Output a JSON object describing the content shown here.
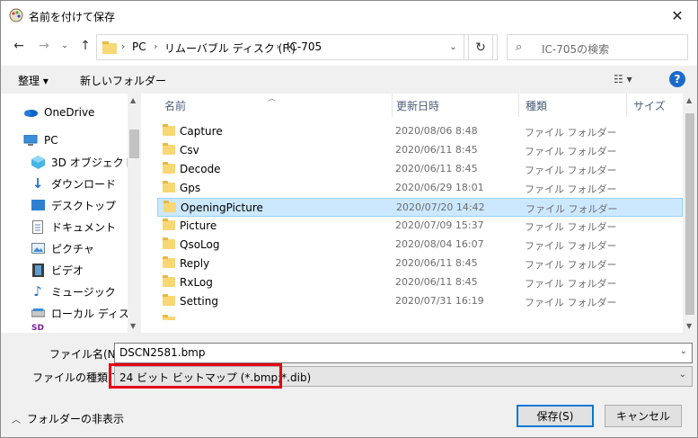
{
  "window": {
    "title": "名前を付けて保存",
    "close_glyph": "✕"
  },
  "address": {
    "crumbs": [
      "PC",
      "リムーバブル ディスク (F:)",
      "IC-705"
    ],
    "search_placeholder": "IC-705の検索"
  },
  "toolbar": {
    "organize": "整理 ▾",
    "new_folder": "新しいフォルダー",
    "help": "?"
  },
  "nav": {
    "items": [
      {
        "label": "OneDrive",
        "icon": "onedrive-icon"
      },
      {
        "label": "PC",
        "icon": "pc-icon"
      },
      {
        "label": "3D オブジェクト",
        "icon": "3d-objects-icon"
      },
      {
        "label": "ダウンロード",
        "icon": "download-icon"
      },
      {
        "label": "デスクトップ",
        "icon": "desktop-icon"
      },
      {
        "label": "ドキュメント",
        "icon": "document-icon"
      },
      {
        "label": "ピクチャ",
        "icon": "picture-icon"
      },
      {
        "label": "ビデオ",
        "icon": "video-icon"
      },
      {
        "label": "ミュージック",
        "icon": "music-icon"
      },
      {
        "label": "ローカル ディスク (C",
        "icon": "drive-icon"
      }
    ]
  },
  "columns": {
    "name": "名前",
    "date": "更新日時",
    "type": "種類",
    "size": "サイズ"
  },
  "files": [
    {
      "name": "Capture",
      "date": "2020/08/06 8:48",
      "type": "ファイル フォルダー"
    },
    {
      "name": "Csv",
      "date": "2020/06/11 8:45",
      "type": "ファイル フォルダー"
    },
    {
      "name": "Decode",
      "date": "2020/06/11 8:45",
      "type": "ファイル フォルダー"
    },
    {
      "name": "Gps",
      "date": "2020/06/29 18:01",
      "type": "ファイル フォルダー"
    },
    {
      "name": "OpeningPicture",
      "date": "2020/07/20 14:42",
      "type": "ファイル フォルダー",
      "selected": true
    },
    {
      "name": "Picture",
      "date": "2020/07/09 15:37",
      "type": "ファイル フォルダー"
    },
    {
      "name": "QsoLog",
      "date": "2020/08/04 16:07",
      "type": "ファイル フォルダー"
    },
    {
      "name": "Reply",
      "date": "2020/06/11 8:45",
      "type": "ファイル フォルダー"
    },
    {
      "name": "RxLog",
      "date": "2020/06/11 8:45",
      "type": "ファイル フォルダー"
    },
    {
      "name": "Setting",
      "date": "2020/07/31 16:19",
      "type": "ファイル フォルダー"
    }
  ],
  "form": {
    "filename_label": "ファイル名(N):",
    "filename_value": "DSCN2581.bmp",
    "filetype_label": "ファイルの種類(T):",
    "filetype_value": "24 ビット ビットマップ (*.bmp;*.dib)"
  },
  "footer": {
    "hide_folders": "フォルダーの非表示",
    "save": "保存(S)",
    "cancel": "キャンセル"
  },
  "colors": {
    "selection": "#cce8ff",
    "highlight_box": "#e60012",
    "accent": "#0078d7"
  }
}
